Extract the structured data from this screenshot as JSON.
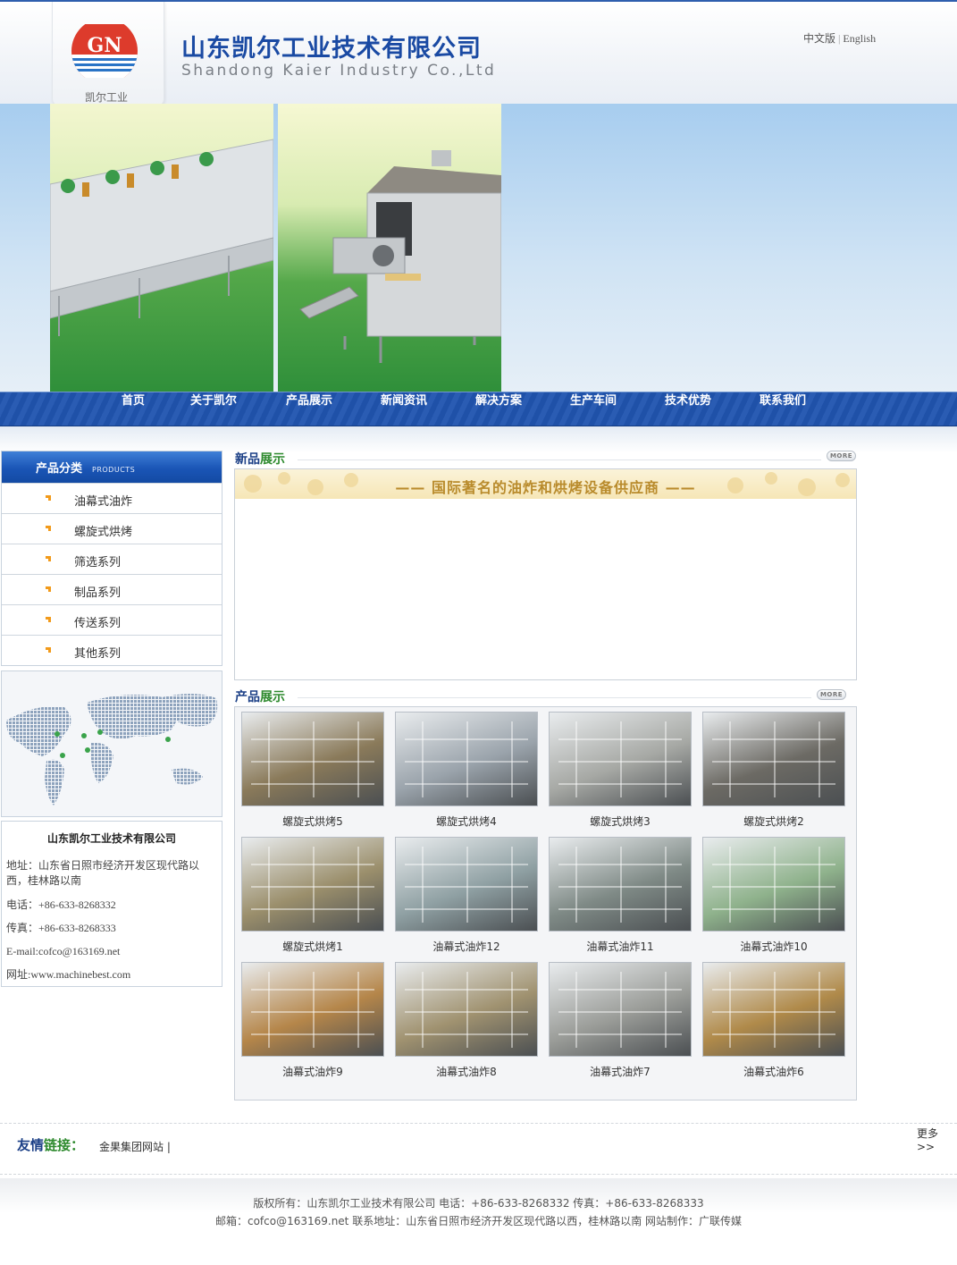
{
  "header": {
    "logo_text": "GN",
    "logo_cn": "凯尔工业",
    "company_cn": "山东凯尔工业技术有限公司",
    "company_en": "Shandong Kaier Industry Co.,Ltd",
    "lang_cn": "中文版",
    "lang_sep": "|",
    "lang_en": "English"
  },
  "nav": {
    "items": [
      "首页",
      "关于凯尔",
      "产品展示",
      "新闻资讯",
      "解决方案",
      "生产车间",
      "技术优势",
      "联系我们"
    ]
  },
  "sidebar": {
    "category_title": "产品分类",
    "category_title_en": "PRODUCTS",
    "categories": [
      "油幕式油炸",
      "螺旋式烘烤",
      "筛选系列",
      "制品系列",
      "传送系列",
      "其他系列"
    ],
    "contact": {
      "title": "山东凯尔工业技术有限公司",
      "address": "地址：山东省日照市经济开发区现代路以西，桂林路以南",
      "phone": "电话：+86-633-8268332",
      "fax": "传真：+86-633-8268333",
      "email": "E-mail:cofco@163169.net",
      "website": "网址:www.machinebest.com"
    }
  },
  "new_products": {
    "title_a": "新品",
    "title_b": "展示",
    "more": "MORE",
    "slogan": "—— 国际著名的油炸和烘烤设备供应商 ——"
  },
  "products": {
    "title_a": "产品",
    "title_b": "展示",
    "more": "MORE",
    "items": [
      {
        "name": "螺旋式烘烤5",
        "color": "#8a7a5a"
      },
      {
        "name": "螺旋式烘烤4",
        "color": "#9aa3ab"
      },
      {
        "name": "螺旋式烘烤3",
        "color": "#a6a8a4"
      },
      {
        "name": "螺旋式烘烤2",
        "color": "#6c6a64"
      },
      {
        "name": "螺旋式烘烤1",
        "color": "#9b8f6c"
      },
      {
        "name": "油幕式油炸12",
        "color": "#8fa0a3"
      },
      {
        "name": "油幕式油炸11",
        "color": "#7f8a86"
      },
      {
        "name": "油幕式油炸10",
        "color": "#8fb28c"
      },
      {
        "name": "油幕式油炸9",
        "color": "#b5864a"
      },
      {
        "name": "油幕式油炸8",
        "color": "#a09270"
      },
      {
        "name": "油幕式油炸7",
        "color": "#9a9c98"
      },
      {
        "name": "油幕式油炸6",
        "color": "#b08a4a"
      }
    ]
  },
  "friend_links": {
    "title_a": "友情",
    "title_b": "链接：",
    "links": [
      "金果集团网站 |"
    ],
    "more": "更多 >>"
  },
  "footer": {
    "line1": "版权所有：山东凯尔工业技术有限公司 电话：+86-633-8268332 传真：+86-633-8268333",
    "line2": "邮箱：cofco@163169.net 联系地址：山东省日照市经济开发区现代路以西，桂林路以南 网站制作：广联传媒"
  },
  "colors": {
    "brand_blue": "#1a4aa3",
    "nav_blue": "#1f51a8",
    "accent_green": "#2e8a2e",
    "logo_red": "#d9382b"
  }
}
